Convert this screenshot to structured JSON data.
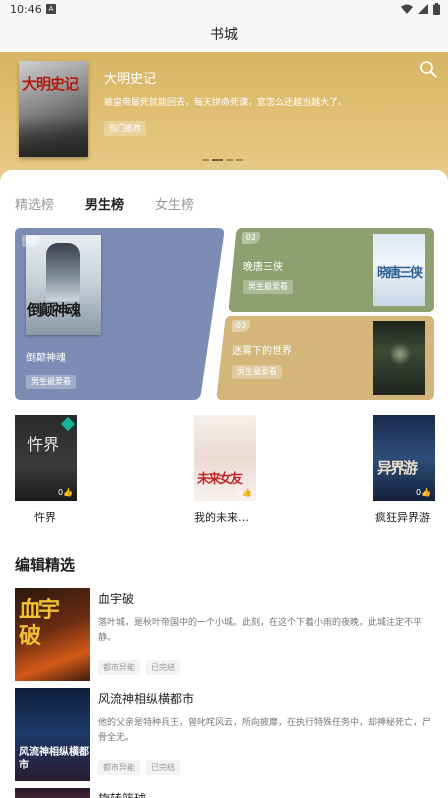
{
  "status": {
    "time": "10:46",
    "notification_glyph": "A"
  },
  "header": {
    "title": "书城"
  },
  "banner": {
    "book_title": "大明史记",
    "cover_text": "大明史记",
    "description": "被皇帝屡死就能回去，每天拼命死谏，官怎么还越当越大了。",
    "tag": "热门推荐",
    "slide_count": 4,
    "active_slide": 1
  },
  "tabs": [
    {
      "label": "精选榜",
      "active": false
    },
    {
      "label": "男生榜",
      "active": true
    },
    {
      "label": "女生榜",
      "active": false
    }
  ],
  "ranking": {
    "top": {
      "rank": "01",
      "title": "倒颠神魂",
      "cover_text": "倒颠神魂",
      "tag": "男生最爱看",
      "color": "#7d8cb4"
    },
    "second": {
      "rank": "02",
      "title": "晚唐三侠",
      "cover_text": "晓唐三侠",
      "tag": "男生最爱看",
      "color": "#8ea070"
    },
    "third": {
      "rank": "03",
      "title": "迷雾下的世界",
      "tag": "男生最爱看",
      "color": "#d4b67a"
    }
  },
  "featured_row": [
    {
      "title": "忤界",
      "cover_text": "忤界",
      "likes": "0"
    },
    {
      "title": "我的未来…",
      "cover_text": "未来女友",
      "likes": "0"
    },
    {
      "title": "疯狂异界游",
      "cover_text": "异界游",
      "likes": "0"
    }
  ],
  "editor_picks": {
    "heading": "编辑精选",
    "items": [
      {
        "title": "血宇破",
        "cover_text": "血宇破",
        "description": "落叶城，是秋叶帝国中的一个小城。此刻，在这个下着小雨的夜晚，此城注定不平静。",
        "tags": [
          "都市异能",
          "已完结"
        ]
      },
      {
        "title": "风流神相纵横都市",
        "cover_text": "风流神相纵横都市",
        "description": "他的父亲是特种兵王，曾叱咤风云，所向披靡，在执行特殊任务中，却神秘死亡，尸骨全无。",
        "tags": [
          "都市异能",
          "已完结"
        ]
      },
      {
        "title": "旋转篮球",
        "description": "",
        "tags": []
      }
    ]
  },
  "colors": {
    "banner_gold": "#dcba6e",
    "tab_accent": "#4a90e2",
    "rank_blue": "#7d8cb4",
    "rank_green": "#8ea070",
    "rank_gold": "#d4b67a"
  }
}
